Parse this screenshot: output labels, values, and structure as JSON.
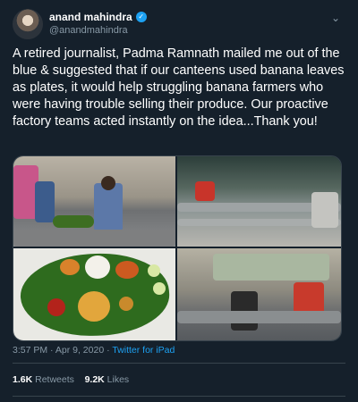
{
  "tweet": {
    "display_name": "anand mahindra",
    "handle": "@anandmahindra",
    "text": "A retired journalist, Padma Ramnath mailed me out of the blue & suggested that if our canteens used banana leaves as plates, it would help struggling banana farmers who were having trouble selling their produce. Our proactive factory teams acted instantly on the idea...Thank you!",
    "time": "3:57 PM",
    "date": "Apr 9, 2020",
    "source": "Twitter for iPad",
    "retweets_count": "1.6K",
    "retweets_label": "Retweets",
    "likes_count": "9.2K",
    "likes_label": "Likes"
  },
  "icons": {
    "verified": "verified-badge-icon",
    "menu": "chevron-down-icon"
  },
  "colors": {
    "background": "#15202b",
    "accent": "#1da1f2",
    "muted": "#8899a6"
  }
}
